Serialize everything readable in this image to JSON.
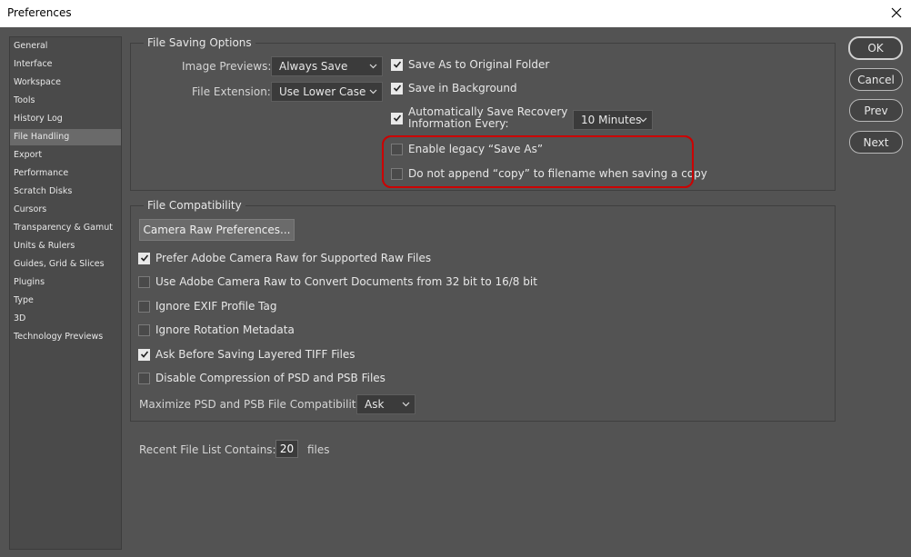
{
  "window": {
    "title": "Preferences"
  },
  "sidebar": {
    "items": [
      {
        "label": "General"
      },
      {
        "label": "Interface"
      },
      {
        "label": "Workspace"
      },
      {
        "label": "Tools"
      },
      {
        "label": "History Log"
      },
      {
        "label": "File Handling",
        "active": true
      },
      {
        "label": "Export"
      },
      {
        "label": "Performance"
      },
      {
        "label": "Scratch Disks"
      },
      {
        "label": "Cursors"
      },
      {
        "label": "Transparency & Gamut"
      },
      {
        "label": "Units & Rulers"
      },
      {
        "label": "Guides, Grid & Slices"
      },
      {
        "label": "Plugins"
      },
      {
        "label": "Type"
      },
      {
        "label": "3D"
      },
      {
        "label": "Technology Previews"
      }
    ]
  },
  "file_saving": {
    "group_label": "File Saving Options",
    "image_previews_label": "Image Previews:",
    "image_previews_value": "Always Save",
    "file_extension_label": "File Extension:",
    "file_extension_value": "Use Lower Case",
    "save_as_original": {
      "label": "Save As to Original Folder",
      "checked": true
    },
    "save_background": {
      "label": "Save in Background",
      "checked": true
    },
    "auto_save": {
      "label_line1": "Automatically Save Recovery",
      "label_line2": "Information Every:",
      "checked": true
    },
    "auto_save_interval": "10 Minutes",
    "legacy_save_as": {
      "label": "Enable legacy “Save As”",
      "checked": false
    },
    "no_copy_append": {
      "label": "Do not append “copy” to filename when saving a copy",
      "checked": false
    }
  },
  "file_compat": {
    "group_label": "File Compatibility",
    "camera_raw_button": "Camera Raw Preferences...",
    "options": [
      {
        "label": "Prefer Adobe Camera Raw for Supported Raw Files",
        "checked": true
      },
      {
        "label": "Use Adobe Camera Raw to Convert Documents from 32 bit to 16/8 bit",
        "checked": false
      },
      {
        "label": "Ignore EXIF Profile Tag",
        "checked": false
      },
      {
        "label": "Ignore Rotation Metadata",
        "checked": false
      },
      {
        "label": "Ask Before Saving Layered TIFF Files",
        "checked": true
      },
      {
        "label": "Disable Compression of PSD and PSB Files",
        "checked": false
      }
    ],
    "maximize_label": "Maximize PSD and PSB File Compatibility:",
    "maximize_value": "Ask"
  },
  "recent_files": {
    "label": "Recent File List Contains:",
    "value": "20",
    "suffix": "files"
  },
  "buttons": {
    "ok": "OK",
    "cancel": "Cancel",
    "prev": "Prev",
    "next": "Next"
  }
}
